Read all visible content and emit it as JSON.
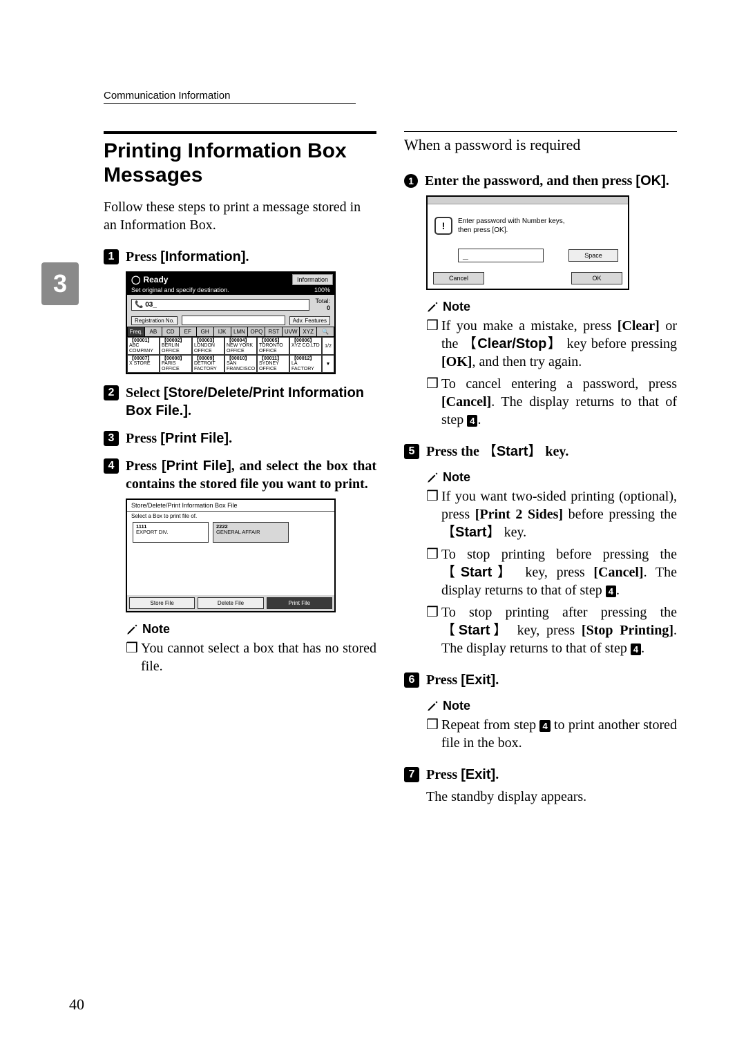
{
  "header": {
    "running": "Communication Information"
  },
  "side_tab": "3",
  "page_number": "40",
  "left": {
    "title": "Printing Information Box Messages",
    "intro": "Follow these steps to print a message stored in an Information Box.",
    "steps": {
      "s1": {
        "n": "1",
        "pre": "Press ",
        "btn": "[Information]",
        "post": "."
      },
      "s2": {
        "n": "2",
        "pre": "Select ",
        "btn": "[Store/Delete/Print Information Box File.]",
        "post": "."
      },
      "s3": {
        "n": "3",
        "pre": "Press ",
        "btn": "[Print File]",
        "post": "."
      },
      "s4": {
        "n": "4",
        "pre": "Press ",
        "btn": "[Print File]",
        "post": ", and select the box that contains the stored file you want to print."
      }
    },
    "note_label": "Note",
    "note_items": {
      "a": "You cannot select a box that has no stored file."
    }
  },
  "right": {
    "subhead": "When a password is required",
    "sub1": {
      "n": "1",
      "pre": "Enter the password, and then press ",
      "btn": "[OK]",
      "post": "."
    },
    "noteA_label": "Note",
    "noteA": {
      "a_pre": "If you make a mistake, press ",
      "a_btn1": "[Clear]",
      "a_mid": " or the ",
      "a_key": "Clear/Stop",
      "a_mid2": " key before pressing ",
      "a_btn2": "[OK]",
      "a_post": ", and then try again.",
      "b_pre": "To cancel entering a password, press ",
      "b_btn": "[Cancel]",
      "b_mid": ". The display returns to that of step ",
      "b_ref": "4",
      "b_post": "."
    },
    "s5": {
      "n": "5",
      "pre": "Press the ",
      "key": "Start",
      "post": " key."
    },
    "noteB_label": "Note",
    "noteB": {
      "a_pre": "If you want two-sided printing (optional), press ",
      "a_btn": "[Print 2 Sides]",
      "a_mid": " before pressing the ",
      "a_key": "Start",
      "a_post": " key.",
      "b_pre": "To stop printing before pressing the ",
      "b_key": "Start",
      "b_mid": " key, press ",
      "b_btn": "[Cancel]",
      "b_mid2": ". The display returns to that of step ",
      "b_ref": "4",
      "b_post": ".",
      "c_pre": "To stop printing after pressing the ",
      "c_key": "Start",
      "c_mid": " key, press ",
      "c_btn": "[Stop Printing]",
      "c_mid2": ". The display returns to that of step ",
      "c_ref": "4",
      "c_post": "."
    },
    "s6": {
      "n": "6",
      "pre": "Press ",
      "btn": "[Exit]",
      "post": "."
    },
    "noteC_label": "Note",
    "noteC": {
      "a_pre": "Repeat from step ",
      "a_ref": "4",
      "a_post": " to print another stored file in the box."
    },
    "s7": {
      "n": "7",
      "pre": "Press ",
      "btn": "[Exit]",
      "post": "."
    },
    "standby": "The standby display appears."
  },
  "mock_ready": {
    "title": "Ready",
    "info_btn": "Information",
    "sub_left": "Set original and specify destination.",
    "sub_right": "100%",
    "dial": "03_",
    "total_label": "Total:",
    "total_value": "0",
    "reg_btn": "Registration No.",
    "adv_btn": "Adv. Features",
    "tabs": [
      "Freq.",
      "AB",
      "CD",
      "EF",
      "GH",
      "IJK",
      "LMN",
      "OPQ",
      "RST",
      "UVW",
      "XYZ"
    ],
    "row1": [
      {
        "id": "【00001】",
        "name": "ABC COMPANY"
      },
      {
        "id": "【00002】",
        "name": "BERLIN OFFICE"
      },
      {
        "id": "【00003】",
        "name": "LONDON OFFICE"
      },
      {
        "id": "【00004】",
        "name": "NEW YORK OFFICE"
      },
      {
        "id": "【00005】",
        "name": "TORONTO OFFICE"
      },
      {
        "id": "【00006】",
        "name": "XYZ CO.LTD"
      }
    ],
    "row2": [
      {
        "id": "【00007】",
        "name": "X STORE"
      },
      {
        "id": "【00008】",
        "name": "PARIS OFFICE"
      },
      {
        "id": "【00009】",
        "name": "DETROIT FACTORY"
      },
      {
        "id": "【00010】",
        "name": "SAN FRANCISCO"
      },
      {
        "id": "【00011】",
        "name": "SYDNEY OFFICE"
      },
      {
        "id": "【00012】",
        "name": "LA FACTORY"
      }
    ],
    "page_ind": "1/2"
  },
  "mock_box": {
    "title": "Store/Delete/Print Information Box File",
    "sub": "Select a Box to print file of.",
    "item1_id": "1111",
    "item1_name": "EXPORT DIV.",
    "item2_id": "2222",
    "item2_name": "GENERAL AFFAIR",
    "btn_store": "Store File",
    "btn_delete": "Delete File",
    "btn_print": "Print File"
  },
  "mock_pass": {
    "msg_line1": "Enter password with Number keys,",
    "msg_line2": "then press [OK].",
    "input": "_",
    "space": "Space",
    "cancel": "Cancel",
    "ok": "OK"
  }
}
